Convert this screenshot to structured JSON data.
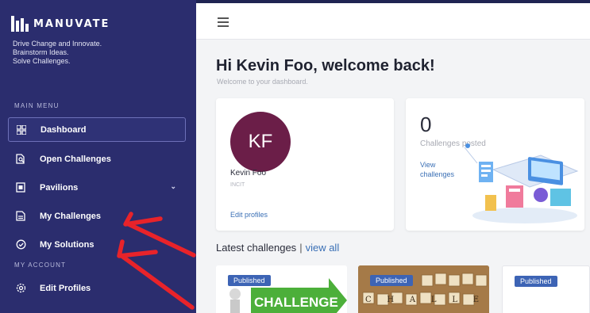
{
  "brand": {
    "name": "MANUVATE",
    "tagline": [
      "Drive Change and Innovate.",
      "Brainstorm Ideas.",
      "Solve Challenges."
    ]
  },
  "sidebar": {
    "main_menu_label": "MAIN MENU",
    "account_label": "MY ACCOUNT",
    "items": [
      {
        "label": "Dashboard",
        "icon": "dashboard-icon"
      },
      {
        "label": "Open Challenges",
        "icon": "search-document-icon"
      },
      {
        "label": "Pavilions",
        "icon": "pavilion-icon"
      },
      {
        "label": "My Challenges",
        "icon": "document-icon"
      },
      {
        "label": "My Solutions",
        "icon": "check-circle-icon"
      },
      {
        "label": "Edit Profiles",
        "icon": "gear-icon"
      }
    ]
  },
  "header": {
    "menu_icon": "hamburger-icon"
  },
  "main": {
    "greeting": "Hi Kevin Foo, welcome back!",
    "subtitle": "Welcome to your dashboard.",
    "profile": {
      "initials": "KF",
      "name": "Kevin Foo",
      "org": "INCIT",
      "edit_link": "Edit profiles"
    },
    "stats": {
      "count": "0",
      "label": "Challenges posted",
      "link": "View challenges"
    },
    "latest": {
      "title": "Latest challenges",
      "separator": "|",
      "view_all": "view all"
    },
    "challenges": [
      {
        "status": "Published",
        "image_text": "CHALLENGE"
      },
      {
        "status": "Published",
        "image_text": "C H A L L E N G E"
      },
      {
        "status": "Published",
        "image_text": ""
      }
    ]
  },
  "colors": {
    "sidebar": "#2b2d6e",
    "accent": "#3a6fb5",
    "avatar": "#6b1e48",
    "badge": "#3d64b5",
    "annotation": "#e8232a"
  }
}
